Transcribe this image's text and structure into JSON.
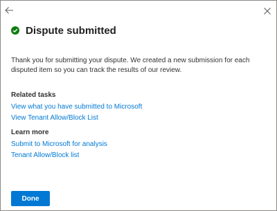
{
  "panel": {
    "title": "Dispute submitted",
    "description": "Thank you for submitting your dispute. We created a new submission for each disputed item so you can track the results of our review."
  },
  "related_tasks": {
    "heading": "Related tasks",
    "links": [
      "View what you have submitted to Microsoft",
      "View Tenant Allow/Block List"
    ]
  },
  "learn_more": {
    "heading": "Learn more",
    "links": [
      "Submit to Microsoft for analysis",
      "Tenant Allow/Block list"
    ]
  },
  "footer": {
    "done_label": "Done"
  },
  "icons": {
    "back": "back-arrow-icon",
    "close": "close-icon",
    "status": "success-check-icon"
  },
  "colors": {
    "accent": "#0078d4",
    "success": "#107c10",
    "border": "#8a8886"
  }
}
